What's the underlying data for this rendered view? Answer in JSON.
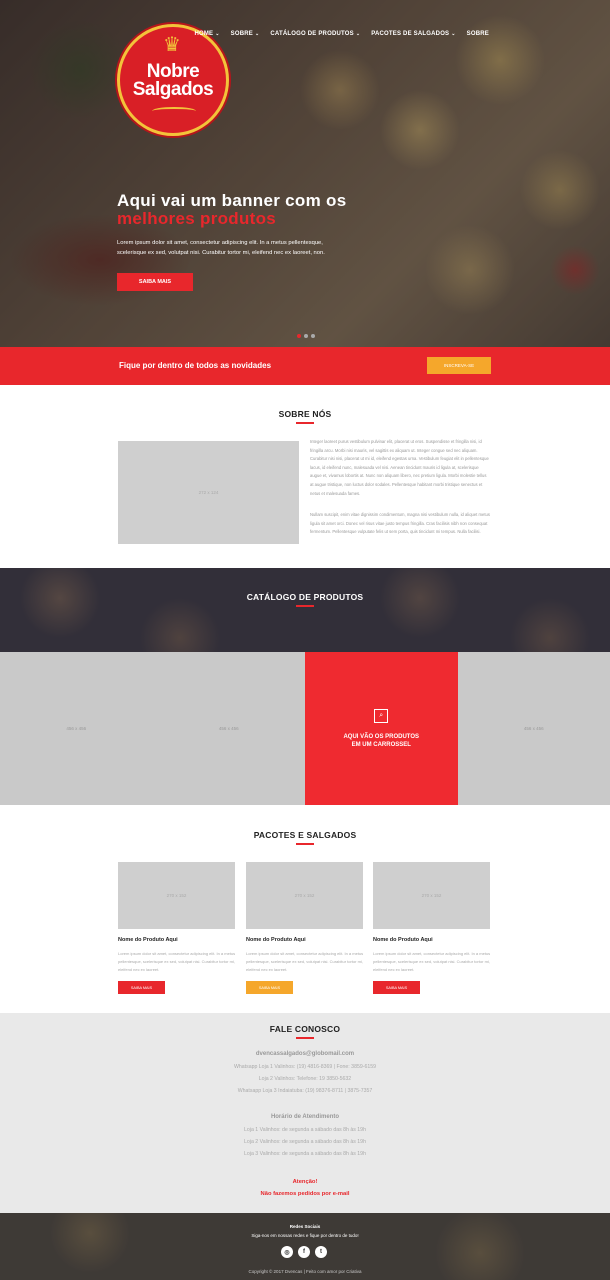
{
  "logo": {
    "crown": "♛",
    "line1": "Nobre",
    "line2": "Salgados"
  },
  "nav": {
    "items": [
      {
        "label": "HOME",
        "dropdown": true
      },
      {
        "label": "SOBRE",
        "dropdown": true
      },
      {
        "label": "CATÁLOGO DE PRODUTOS",
        "dropdown": true
      },
      {
        "label": "PACOTES DE SALGADOS",
        "dropdown": true
      },
      {
        "label": "SOBRE",
        "dropdown": false
      }
    ],
    "chevron": "⌄"
  },
  "hero": {
    "title_line1": "Aqui vai um banner com os",
    "title_line2": "melhores produtos",
    "text": "Lorem ipsum dolor sit amet, consectetur adipiscing elit. In a metus pellentesque, scelerisque ex sed, volutpat nisi. Curabitur tortor mi, eleifend nec ex laoreet, non.",
    "button": "SAIBA MAIS"
  },
  "news": {
    "text": "Fique por dentro de todos as novidades",
    "button": "INSCREVA-SE"
  },
  "about": {
    "title": "SOBRE NÓS",
    "image_label": "272 x 124",
    "p1": "Integer laoreet purus vestibulum pulvinar elit, placerat ut eros. Suspendisse et fringilla nisi, id fringilla arcu. Morbi nisi mauris, vel sagittis ex aliquam ut. Integer congue sed nec aliquam. Curabitur nisi nisi, placerat ut mi id, eleifend egestas urna. Vestibulum feugiat elit in pellentesque lacus, id eleifend nunc, malesuada vel nisi. Aenean tincidunt mauris id ligula at, scelerisque augue et, vivamus lobortis at. Nunc non aliquam libero, nec pretium ligula. Morbi molestie tellus at augue tristique, non luctus dolor sodales. Pellentesque habitant morbi tristique senectus et netus et malesuada fames.",
    "p2": "Nullam suscipit, enim vitae dignissim condimentum, magna nisi vestibulum nulla, id aliquet metus ligula sit amet orci. Donec vel risus vitae justo tempus fringilla. Cras facilisis nibh non consequat fermentum. Pellentesque vulputate felis ut sem porta, quis tincidunt mi tempus. Nulla facilisi."
  },
  "catalog": {
    "title": "CATÁLOGO DE PRODUTOS",
    "tiles": [
      "456 x 456",
      "456 x 456",
      "",
      "456 x 456"
    ],
    "highlight": {
      "icon": "⌕",
      "line1": "AQUI VÃO OS PRODUTOS",
      "line2": "EM UM CARROSSEL"
    }
  },
  "packages": {
    "title": "PACOTES E SALGADOS",
    "items": [
      {
        "image": "270 x 152",
        "name": "Nome do Produto Aqui",
        "desc": "Lorem ipsum dolor sit amet, consectetur adipiscing elit. In a metus pellentesque, scelerisque ex sed, volutpat nisi. Curabitur tortor mi, eleifend nec ex laoreet.",
        "button": "SAIBA MAIS",
        "color": "#e8272c"
      },
      {
        "image": "270 x 152",
        "name": "Nome do Produto Aqui",
        "desc": "Lorem ipsum dolor sit amet, consectetur adipiscing elit. In a metus pellentesque, scelerisque ex sed, volutpat nisi. Curabitur tortor mi, eleifend nec ex laoreet.",
        "button": "SAIBA MAIS",
        "color": "#f5a72b"
      },
      {
        "image": "270 x 152",
        "name": "Nome do Produto Aqui",
        "desc": "Lorem ipsum dolor sit amet, consectetur adipiscing elit. In a metus pellentesque, scelerisque ex sed, volutpat nisi. Curabitur tortor mi, eleifend nec ex laoreet.",
        "button": "SAIBA MAIS",
        "color": "#e8272c"
      }
    ]
  },
  "contact": {
    "title": "FALE CONOSCO",
    "email": "dvencassalgados@globomail.com",
    "phones": [
      "Whatsapp Loja 1 Valinhos: (19) 4816-8369 | Fone: 3859-6159",
      "Loja 2 Valinhos: Telefone: 19 3850-5632",
      "Whatsapp Loja 3 Indaiatuba: (19) 98376-8711 | 3875-7357"
    ],
    "hours_title": "Horário de Atendimento",
    "hours": [
      "Loja 1 Valinhos: de segunda a sábado das 8h às 19h",
      "Loja 2 Valinhos: de segunda a sábado das 8h às 19h",
      "Loja 3 Valinhos: de segunda a sábado das 8h às 19h"
    ],
    "alert_title": "Atenção!",
    "alert_text": "Não fazemos pedidos por e-mail"
  },
  "footer": {
    "social_title": "Redes Sociais",
    "social_text": "Siga-nos em nossas redes e fique por dentro de tudo!",
    "socials": [
      {
        "name": "instagram",
        "glyph": "◎"
      },
      {
        "name": "facebook",
        "glyph": "f"
      },
      {
        "name": "twitter",
        "glyph": "t"
      }
    ],
    "copyright": "Copyright © 2017 Dvencas | Feito com amor por Criativa"
  }
}
